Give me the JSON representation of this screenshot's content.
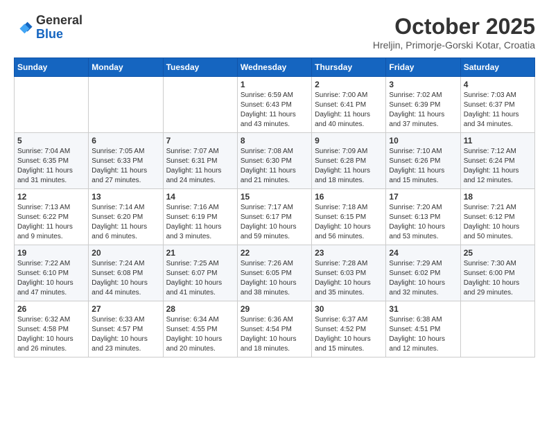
{
  "logo": {
    "general": "General",
    "blue": "Blue"
  },
  "header": {
    "month_title": "October 2025",
    "subtitle": "Hreljin, Primorje-Gorski Kotar, Croatia"
  },
  "weekdays": [
    "Sunday",
    "Monday",
    "Tuesday",
    "Wednesday",
    "Thursday",
    "Friday",
    "Saturday"
  ],
  "weeks": [
    [
      {
        "day": "",
        "sunrise": "",
        "sunset": "",
        "daylight": ""
      },
      {
        "day": "",
        "sunrise": "",
        "sunset": "",
        "daylight": ""
      },
      {
        "day": "",
        "sunrise": "",
        "sunset": "",
        "daylight": ""
      },
      {
        "day": "1",
        "sunrise": "Sunrise: 6:59 AM",
        "sunset": "Sunset: 6:43 PM",
        "daylight": "Daylight: 11 hours and 43 minutes."
      },
      {
        "day": "2",
        "sunrise": "Sunrise: 7:00 AM",
        "sunset": "Sunset: 6:41 PM",
        "daylight": "Daylight: 11 hours and 40 minutes."
      },
      {
        "day": "3",
        "sunrise": "Sunrise: 7:02 AM",
        "sunset": "Sunset: 6:39 PM",
        "daylight": "Daylight: 11 hours and 37 minutes."
      },
      {
        "day": "4",
        "sunrise": "Sunrise: 7:03 AM",
        "sunset": "Sunset: 6:37 PM",
        "daylight": "Daylight: 11 hours and 34 minutes."
      }
    ],
    [
      {
        "day": "5",
        "sunrise": "Sunrise: 7:04 AM",
        "sunset": "Sunset: 6:35 PM",
        "daylight": "Daylight: 11 hours and 31 minutes."
      },
      {
        "day": "6",
        "sunrise": "Sunrise: 7:05 AM",
        "sunset": "Sunset: 6:33 PM",
        "daylight": "Daylight: 11 hours and 27 minutes."
      },
      {
        "day": "7",
        "sunrise": "Sunrise: 7:07 AM",
        "sunset": "Sunset: 6:31 PM",
        "daylight": "Daylight: 11 hours and 24 minutes."
      },
      {
        "day": "8",
        "sunrise": "Sunrise: 7:08 AM",
        "sunset": "Sunset: 6:30 PM",
        "daylight": "Daylight: 11 hours and 21 minutes."
      },
      {
        "day": "9",
        "sunrise": "Sunrise: 7:09 AM",
        "sunset": "Sunset: 6:28 PM",
        "daylight": "Daylight: 11 hours and 18 minutes."
      },
      {
        "day": "10",
        "sunrise": "Sunrise: 7:10 AM",
        "sunset": "Sunset: 6:26 PM",
        "daylight": "Daylight: 11 hours and 15 minutes."
      },
      {
        "day": "11",
        "sunrise": "Sunrise: 7:12 AM",
        "sunset": "Sunset: 6:24 PM",
        "daylight": "Daylight: 11 hours and 12 minutes."
      }
    ],
    [
      {
        "day": "12",
        "sunrise": "Sunrise: 7:13 AM",
        "sunset": "Sunset: 6:22 PM",
        "daylight": "Daylight: 11 hours and 9 minutes."
      },
      {
        "day": "13",
        "sunrise": "Sunrise: 7:14 AM",
        "sunset": "Sunset: 6:20 PM",
        "daylight": "Daylight: 11 hours and 6 minutes."
      },
      {
        "day": "14",
        "sunrise": "Sunrise: 7:16 AM",
        "sunset": "Sunset: 6:19 PM",
        "daylight": "Daylight: 11 hours and 3 minutes."
      },
      {
        "day": "15",
        "sunrise": "Sunrise: 7:17 AM",
        "sunset": "Sunset: 6:17 PM",
        "daylight": "Daylight: 10 hours and 59 minutes."
      },
      {
        "day": "16",
        "sunrise": "Sunrise: 7:18 AM",
        "sunset": "Sunset: 6:15 PM",
        "daylight": "Daylight: 10 hours and 56 minutes."
      },
      {
        "day": "17",
        "sunrise": "Sunrise: 7:20 AM",
        "sunset": "Sunset: 6:13 PM",
        "daylight": "Daylight: 10 hours and 53 minutes."
      },
      {
        "day": "18",
        "sunrise": "Sunrise: 7:21 AM",
        "sunset": "Sunset: 6:12 PM",
        "daylight": "Daylight: 10 hours and 50 minutes."
      }
    ],
    [
      {
        "day": "19",
        "sunrise": "Sunrise: 7:22 AM",
        "sunset": "Sunset: 6:10 PM",
        "daylight": "Daylight: 10 hours and 47 minutes."
      },
      {
        "day": "20",
        "sunrise": "Sunrise: 7:24 AM",
        "sunset": "Sunset: 6:08 PM",
        "daylight": "Daylight: 10 hours and 44 minutes."
      },
      {
        "day": "21",
        "sunrise": "Sunrise: 7:25 AM",
        "sunset": "Sunset: 6:07 PM",
        "daylight": "Daylight: 10 hours and 41 minutes."
      },
      {
        "day": "22",
        "sunrise": "Sunrise: 7:26 AM",
        "sunset": "Sunset: 6:05 PM",
        "daylight": "Daylight: 10 hours and 38 minutes."
      },
      {
        "day": "23",
        "sunrise": "Sunrise: 7:28 AM",
        "sunset": "Sunset: 6:03 PM",
        "daylight": "Daylight: 10 hours and 35 minutes."
      },
      {
        "day": "24",
        "sunrise": "Sunrise: 7:29 AM",
        "sunset": "Sunset: 6:02 PM",
        "daylight": "Daylight: 10 hours and 32 minutes."
      },
      {
        "day": "25",
        "sunrise": "Sunrise: 7:30 AM",
        "sunset": "Sunset: 6:00 PM",
        "daylight": "Daylight: 10 hours and 29 minutes."
      }
    ],
    [
      {
        "day": "26",
        "sunrise": "Sunrise: 6:32 AM",
        "sunset": "Sunset: 4:58 PM",
        "daylight": "Daylight: 10 hours and 26 minutes."
      },
      {
        "day": "27",
        "sunrise": "Sunrise: 6:33 AM",
        "sunset": "Sunset: 4:57 PM",
        "daylight": "Daylight: 10 hours and 23 minutes."
      },
      {
        "day": "28",
        "sunrise": "Sunrise: 6:34 AM",
        "sunset": "Sunset: 4:55 PM",
        "daylight": "Daylight: 10 hours and 20 minutes."
      },
      {
        "day": "29",
        "sunrise": "Sunrise: 6:36 AM",
        "sunset": "Sunset: 4:54 PM",
        "daylight": "Daylight: 10 hours and 18 minutes."
      },
      {
        "day": "30",
        "sunrise": "Sunrise: 6:37 AM",
        "sunset": "Sunset: 4:52 PM",
        "daylight": "Daylight: 10 hours and 15 minutes."
      },
      {
        "day": "31",
        "sunrise": "Sunrise: 6:38 AM",
        "sunset": "Sunset: 4:51 PM",
        "daylight": "Daylight: 10 hours and 12 minutes."
      },
      {
        "day": "",
        "sunrise": "",
        "sunset": "",
        "daylight": ""
      }
    ]
  ]
}
